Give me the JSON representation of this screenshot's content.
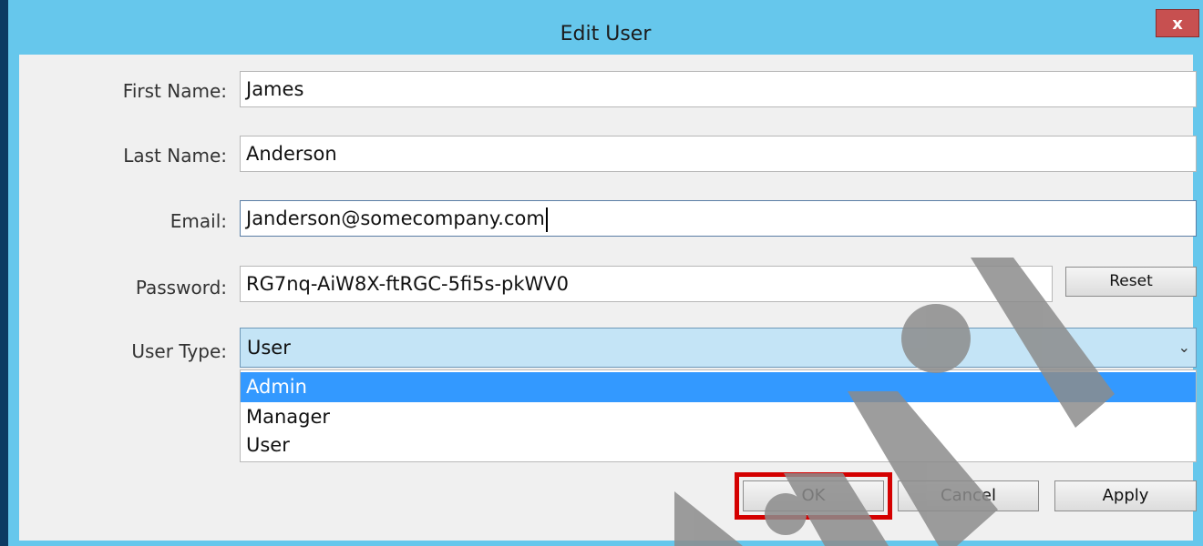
{
  "window": {
    "title": "Edit User",
    "close_glyph": "x"
  },
  "form": {
    "first_name_label": "First Name:",
    "first_name_value": "James",
    "last_name_label": "Last Name:",
    "last_name_value": "Anderson",
    "email_label": "Email:",
    "email_value": "Janderson@somecompany.com",
    "password_label": "Password:",
    "password_value": "RG7nq-AiW8X-ftRGC-5fi5s-pkWV0",
    "reset_label": "Reset",
    "user_type_label": "User Type:",
    "user_type_value": "User",
    "user_type_options": [
      "Admin",
      "Manager",
      "User"
    ],
    "highlighted_option": "Admin"
  },
  "buttons": {
    "ok_label": "OK",
    "cancel_label": "Cancel",
    "apply_label": "Apply"
  },
  "colors": {
    "titlebar": "#66c7ec",
    "close_button": "#c75050",
    "selection": "#3399ff",
    "highlight_box": "#d40000",
    "watermark": "#8c8c8c"
  },
  "icons": {
    "close": "close-icon",
    "dropdown": "chevron-down-icon"
  }
}
